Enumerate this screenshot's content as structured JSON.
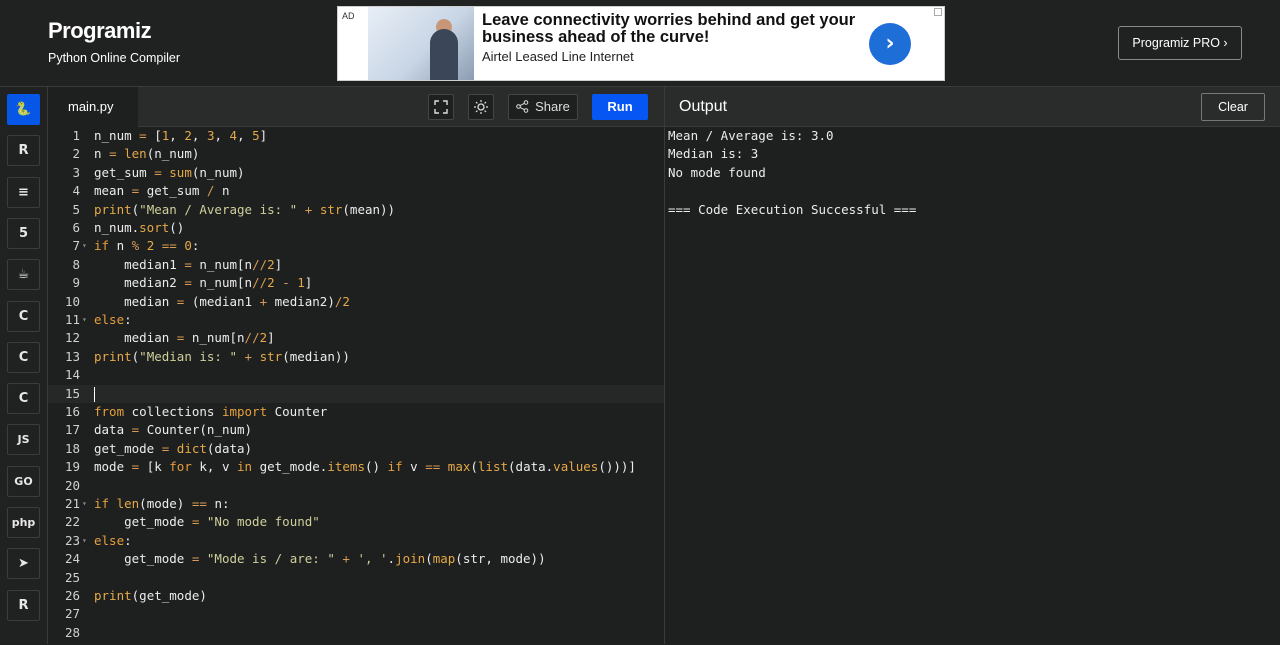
{
  "header": {
    "logo": "Programiz",
    "subtitle": "Python Online Compiler",
    "pro_button": "Programiz PRO ›"
  },
  "ad": {
    "tag": "AD",
    "headline": "Leave connectivity worries behind and get your business ahead of the curve!",
    "sub": "Airtel Leased Line Internet"
  },
  "rail": {
    "items": [
      {
        "name": "python",
        "label": "🐍",
        "active": true
      },
      {
        "name": "r",
        "label": "R",
        "active": false
      },
      {
        "name": "sql",
        "label": "≡",
        "active": false
      },
      {
        "name": "html",
        "label": "5",
        "active": false
      },
      {
        "name": "java",
        "label": "☕",
        "active": false
      },
      {
        "name": "c",
        "label": "C",
        "active": false
      },
      {
        "name": "cpp",
        "label": "C",
        "active": false
      },
      {
        "name": "csharp",
        "label": "C",
        "active": false
      },
      {
        "name": "js",
        "label": "JS",
        "active": false
      },
      {
        "name": "go",
        "label": "GO",
        "active": false
      },
      {
        "name": "php",
        "label": "php",
        "active": false
      },
      {
        "name": "swift",
        "label": "➤",
        "active": false
      },
      {
        "name": "rust",
        "label": "R",
        "active": false
      }
    ]
  },
  "editor": {
    "file_tab": "main.py",
    "share_label": "Share",
    "run_label": "Run",
    "current_line": 15,
    "lines": [
      "n_num = [1, 2, 3, 4, 5]",
      "n = len(n_num)",
      "get_sum = sum(n_num)",
      "mean = get_sum / n",
      "print(\"Mean / Average is: \" + str(mean))",
      "n_num.sort()",
      "if n % 2 == 0:",
      "    median1 = n_num[n//2]",
      "    median2 = n_num[n//2 - 1]",
      "    median = (median1 + median2)/2",
      "else:",
      "    median = n_num[n//2]",
      "print(\"Median is: \" + str(median))",
      "",
      "",
      "from collections import Counter",
      "data = Counter(n_num)",
      "get_mode = dict(data)",
      "mode = [k for k, v in get_mode.items() if v == max(list(data.values()))]",
      "",
      "if len(mode) == n:",
      "    get_mode = \"No mode found\"",
      "else:",
      "    get_mode = \"Mode is / are: \" + ', '.join(map(str, mode))",
      "",
      "print(get_mode)",
      "",
      ""
    ],
    "fold_lines": [
      7,
      11,
      21,
      23
    ]
  },
  "output": {
    "title": "Output",
    "clear_label": "Clear",
    "lines": [
      "Mean / Average is: 3.0",
      "Median is: 3",
      "No mode found",
      "",
      "=== Code Execution Successful ==="
    ]
  }
}
